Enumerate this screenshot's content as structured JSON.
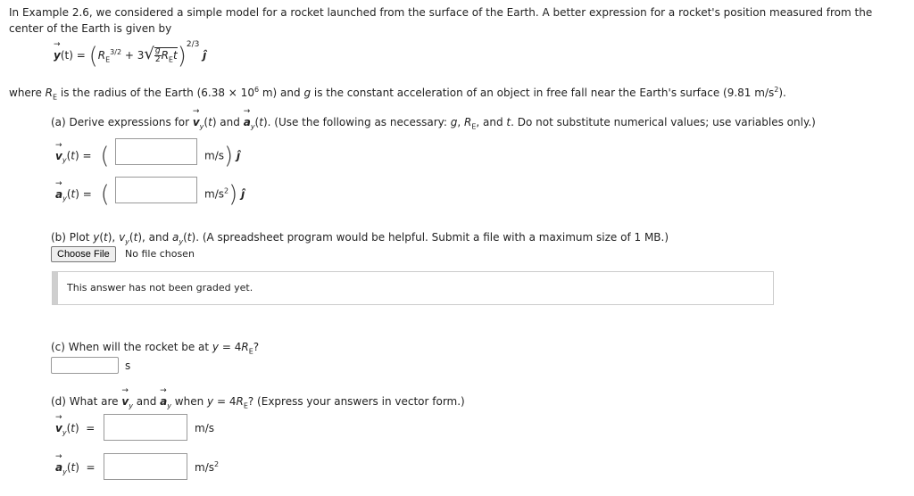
{
  "intro": {
    "text": "In Example 2.6, we considered a simple model for a rocket launched from the surface of the Earth. A better expression for a rocket's position measured from the center of the Earth is given by"
  },
  "equation": {
    "lhs": "y(t) =",
    "base": "R",
    "base_sub": "E",
    "base_sup": "3/2",
    "plus": "+ 3",
    "frac_num": "g",
    "frac_den": "2",
    "radicand_tail": "R",
    "radicand_sub": "E",
    "radicand_t": "t",
    "outer_sup": "2/3",
    "unit_vector": "ĵ"
  },
  "where_line": "where R_E is the radius of the Earth (6.38 × 10^6 m) and g is the constant acceleration of an object in free fall near the Earth's surface (9.81 m/s^2).",
  "part_a": {
    "prompt": "(a) Derive expressions for v_y(t) and a_y(t). (Use the following as necessary: g, R_E, and t. Do not substitute numerical values; use variables only.)",
    "v_label": "v_y(t) =",
    "v_unit": "m/s",
    "a_label": "a_y(t) =",
    "a_unit": "m/s²",
    "unit_vector": "ĵ",
    "v_value": "",
    "a_value": ""
  },
  "part_b": {
    "prompt": "(b) Plot y(t), v_y(t), and a_y(t). (A spreadsheet program would be helpful. Submit a file with a maximum size of 1 MB.)",
    "choose_file_label": "Choose File",
    "file_status": "No file chosen",
    "graded_message": "This answer has not been graded yet."
  },
  "part_c": {
    "prompt": "(c) When will the rocket be at y = 4R_E?",
    "unit": "s",
    "value": ""
  },
  "part_d": {
    "prompt": "(d) What are v_y and a_y when y = 4R_E? (Express your answers in vector form.)",
    "v_label": "v_y(t) =",
    "v_unit": "m/s",
    "a_label": "a_y(t) =",
    "a_unit": "m/s²",
    "v_value": "",
    "a_value": ""
  }
}
